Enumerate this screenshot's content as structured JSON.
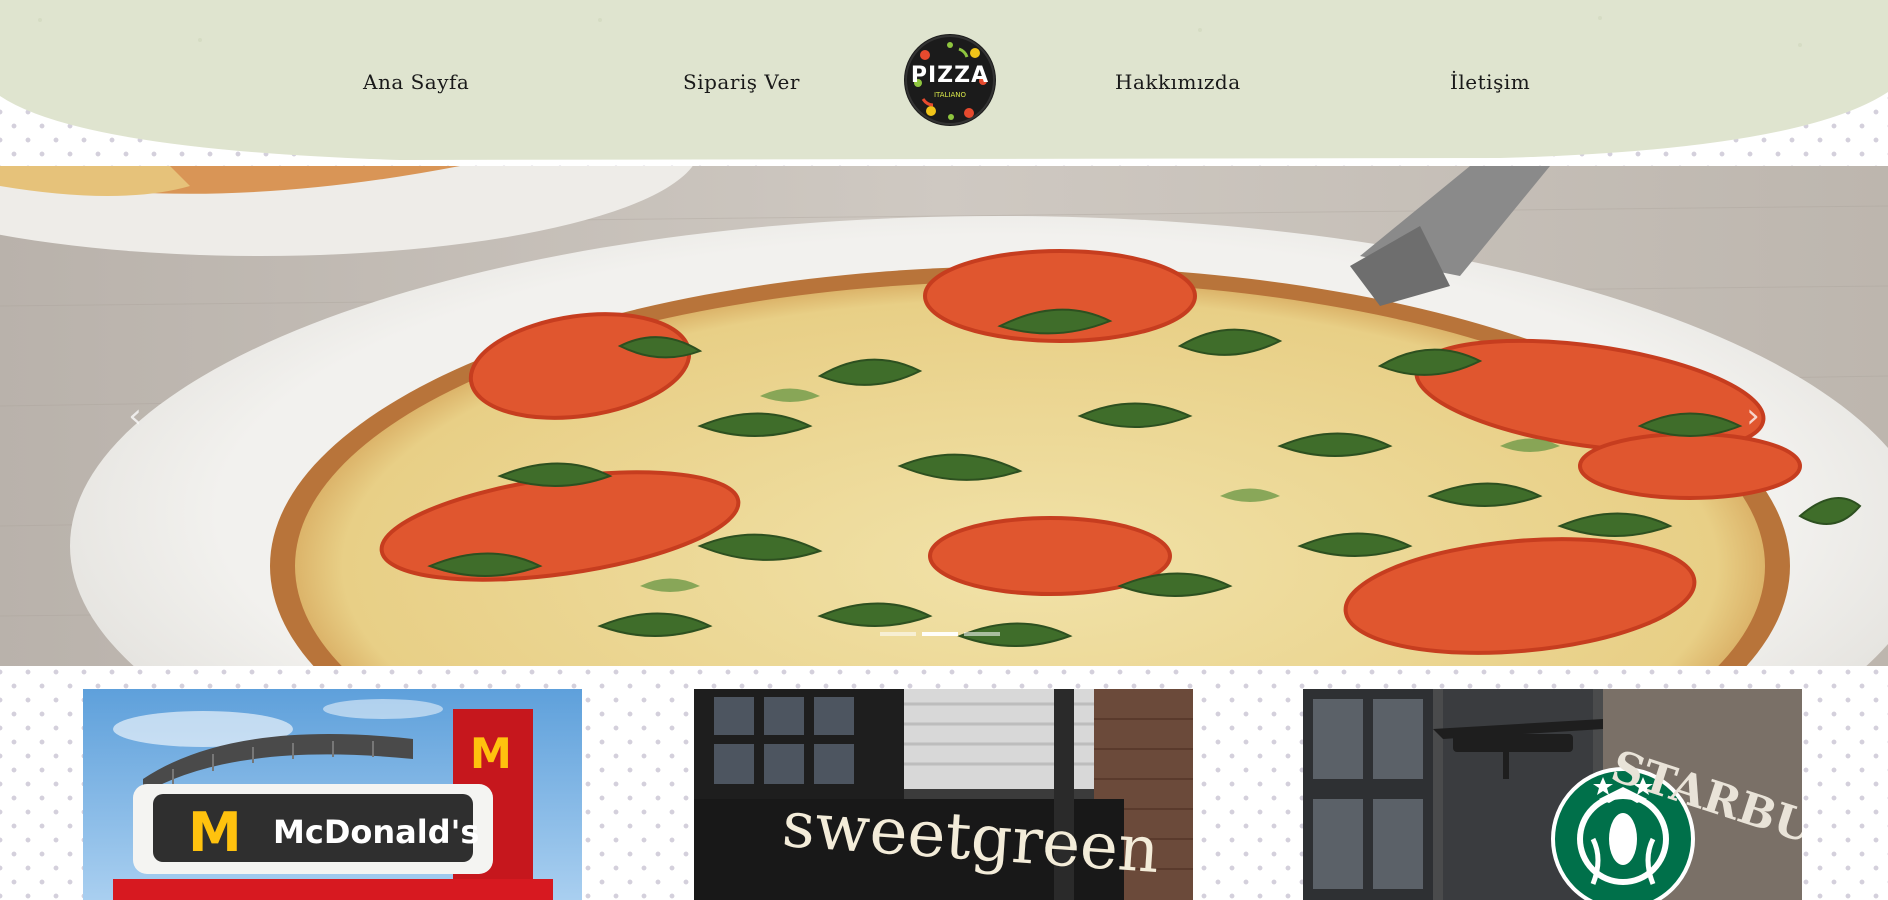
{
  "nav": {
    "items": [
      {
        "label": "Ana Sayfa"
      },
      {
        "label": "Sipariş Ver"
      },
      {
        "label": "Hakkımızda"
      },
      {
        "label": "İletişim"
      }
    ],
    "logo": {
      "title": "PIZZA",
      "subtitle": "ITALIANO"
    }
  },
  "hero": {
    "prev_arrow": "‹",
    "next_arrow": "›",
    "slide_count": 3,
    "active_slide": 1
  },
  "cards": [
    {
      "sign_text": "McDonald's",
      "logo_mark": "M"
    },
    {
      "sign_text": "sweetgreen"
    },
    {
      "sign_text": "STARBUCKS"
    }
  ],
  "colors": {
    "header_band": "#dfe4cf",
    "pattern_dots": "#d4d0dc",
    "mcdonalds_red": "#d71920",
    "mcdonalds_gold": "#ffc20e",
    "starbucks_green": "#00704a"
  }
}
